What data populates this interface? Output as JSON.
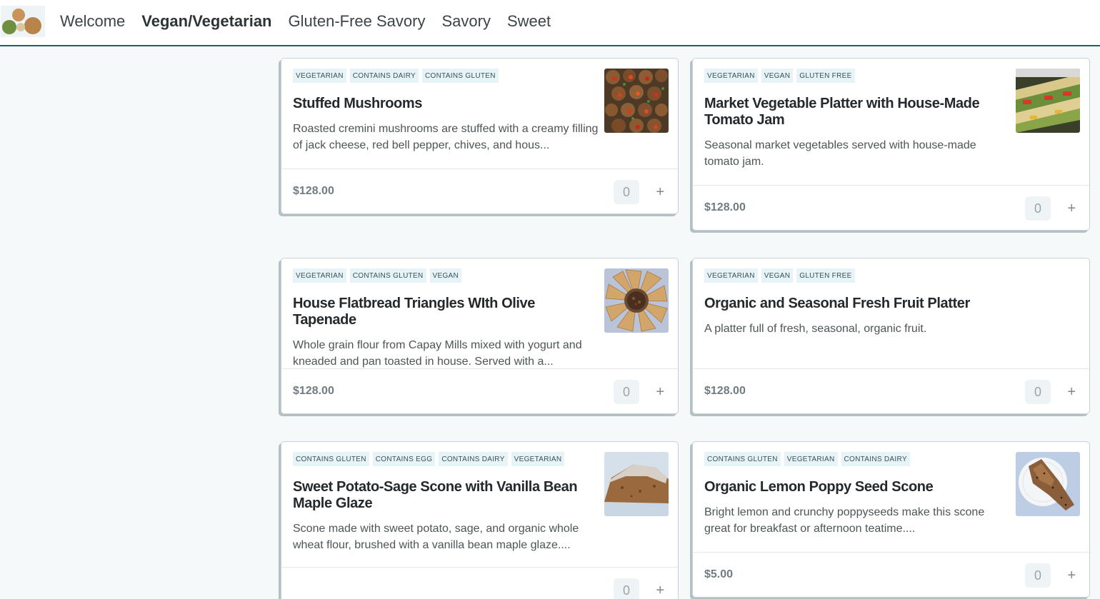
{
  "nav": {
    "items": [
      {
        "label": "Welcome"
      },
      {
        "label": "Vegan/Vegetarian"
      },
      {
        "label": "Gluten-Free Savory"
      },
      {
        "label": "Savory"
      },
      {
        "label": "Sweet"
      }
    ],
    "active_item": "Vegan/Vegetarian"
  },
  "products": [
    {
      "tags": [
        "VEGETARIAN",
        "CONTAINS DAIRY",
        "CONTAINS GLUTEN"
      ],
      "title": "Stuffed Mushrooms",
      "description": "Roasted cremini mushrooms are stuffed with a creamy filling of jack cheese, red bell pepper, chives, and hous...",
      "price": "$128.00",
      "quantity": "0",
      "has_image": true
    },
    {
      "tags": [
        "VEGETARIAN",
        "VEGAN",
        "GLUTEN FREE"
      ],
      "title": "Market Vegetable Platter with House-Made Tomato Jam",
      "description": "Seasonal market vegetables served with house-made tomato jam.",
      "price": "$128.00",
      "quantity": "0",
      "has_image": true
    },
    {
      "tags": [
        "VEGETARIAN",
        "CONTAINS GLUTEN",
        "VEGAN"
      ],
      "title": "House Flatbread Triangles WIth Olive Tapenade",
      "description": "Whole grain flour from Capay Mills mixed with yogurt and kneaded and pan toasted in house. Served with a...",
      "price": "$128.00",
      "quantity": "0",
      "has_image": true
    },
    {
      "tags": [
        "VEGETARIAN",
        "VEGAN",
        "GLUTEN FREE"
      ],
      "title": "Organic and Seasonal Fresh Fruit Platter",
      "description": "A platter full of fresh, seasonal, organic fruit.",
      "price": "$128.00",
      "quantity": "0",
      "has_image": false
    },
    {
      "tags": [
        "CONTAINS GLUTEN",
        "CONTAINS EGG",
        "CONTAINS DAIRY",
        "VEGETARIAN"
      ],
      "title": "Sweet Potato-Sage Scone with Vanilla Bean Maple Glaze",
      "description": "Scone made with sweet potato, sage, and organic whole wheat flour, brushed with a vanilla bean maple glaze....",
      "price": "",
      "quantity": "0",
      "has_image": true
    },
    {
      "tags": [
        "CONTAINS GLUTEN",
        "VEGETARIAN",
        "CONTAINS DAIRY"
      ],
      "title": "Organic Lemon Poppy Seed Scone",
      "description": "Bright lemon and crunchy poppyseeds make this scone great for breakfast or afternoon teatime....",
      "price": "$5.00",
      "quantity": "0",
      "has_image": true
    }
  ],
  "icons": {
    "add": "+"
  },
  "colors": {
    "nav_border": "#2f5a5f",
    "tag_bg": "#e6f3f7",
    "page_bg": "#f5f9fa"
  }
}
